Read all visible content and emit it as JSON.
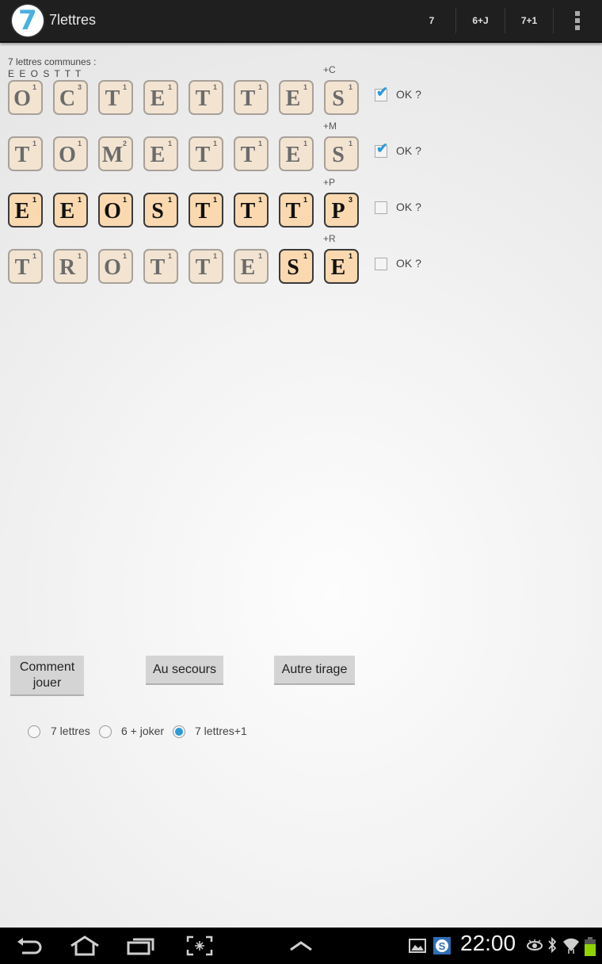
{
  "action_bar": {
    "app_icon_glyph": "7",
    "title": "7lettres",
    "buttons": [
      {
        "label": "7"
      },
      {
        "label": "6+J"
      },
      {
        "label": "7+1"
      }
    ],
    "overflow_icon": "overflow-menu-icon"
  },
  "common": {
    "label": "7 lettres communes :",
    "letters": "E E O S T T T"
  },
  "rows": [
    {
      "plus": "+C",
      "checked": true,
      "ok_label": "OK ?",
      "tiles": [
        {
          "letter": "O",
          "value": "1",
          "active": false
        },
        {
          "letter": "C",
          "value": "3",
          "active": false
        },
        {
          "letter": "T",
          "value": "1",
          "active": false
        },
        {
          "letter": "E",
          "value": "1",
          "active": false
        },
        {
          "letter": "T",
          "value": "1",
          "active": false
        },
        {
          "letter": "T",
          "value": "1",
          "active": false
        },
        {
          "letter": "E",
          "value": "1",
          "active": false
        },
        {
          "letter": "S",
          "value": "1",
          "active": false
        }
      ]
    },
    {
      "plus": "+M",
      "checked": true,
      "ok_label": "OK ?",
      "tiles": [
        {
          "letter": "T",
          "value": "1",
          "active": false
        },
        {
          "letter": "O",
          "value": "1",
          "active": false
        },
        {
          "letter": "M",
          "value": "2",
          "active": false
        },
        {
          "letter": "E",
          "value": "1",
          "active": false
        },
        {
          "letter": "T",
          "value": "1",
          "active": false
        },
        {
          "letter": "T",
          "value": "1",
          "active": false
        },
        {
          "letter": "E",
          "value": "1",
          "active": false
        },
        {
          "letter": "S",
          "value": "1",
          "active": false
        }
      ]
    },
    {
      "plus": "+P",
      "checked": false,
      "ok_label": "OK ?",
      "tiles": [
        {
          "letter": "E",
          "value": "1",
          "active": true
        },
        {
          "letter": "E",
          "value": "1",
          "active": true
        },
        {
          "letter": "O",
          "value": "1",
          "active": true
        },
        {
          "letter": "S",
          "value": "1",
          "active": true
        },
        {
          "letter": "T",
          "value": "1",
          "active": true
        },
        {
          "letter": "T",
          "value": "1",
          "active": true
        },
        {
          "letter": "T",
          "value": "1",
          "active": true
        },
        {
          "letter": "P",
          "value": "3",
          "active": true
        }
      ]
    },
    {
      "plus": "+R",
      "checked": false,
      "ok_label": "OK ?",
      "tiles": [
        {
          "letter": "T",
          "value": "1",
          "active": false
        },
        {
          "letter": "R",
          "value": "1",
          "active": false
        },
        {
          "letter": "O",
          "value": "1",
          "active": false
        },
        {
          "letter": "T",
          "value": "1",
          "active": false
        },
        {
          "letter": "T",
          "value": "1",
          "active": false
        },
        {
          "letter": "E",
          "value": "1",
          "active": false
        },
        {
          "letter": "S",
          "value": "1",
          "active": true
        },
        {
          "letter": "E",
          "value": "1",
          "active": true
        }
      ]
    }
  ],
  "buttons": {
    "how_to_play": "Comment\njouer",
    "help": "Au secours",
    "new_draw": "Autre tirage"
  },
  "modes": [
    {
      "label": "7 lettres",
      "selected": false
    },
    {
      "label": "6 + joker",
      "selected": false
    },
    {
      "label": "7 lettres+1",
      "selected": true
    }
  ],
  "system_bar": {
    "clock": "22:00",
    "icons": [
      "back-icon",
      "home-icon",
      "recent-apps-icon",
      "screenshot-icon",
      "up-arrow-icon",
      "gallery-icon",
      "skype-icon",
      "eye-icon",
      "bluetooth-icon",
      "wifi-icon",
      "battery-icon"
    ],
    "battery_color": "#8fd400",
    "accent": "#2b9bd8"
  }
}
